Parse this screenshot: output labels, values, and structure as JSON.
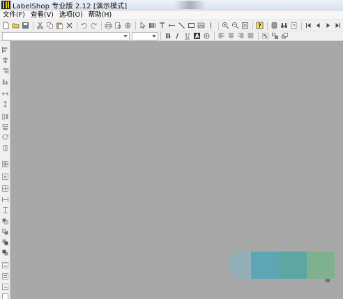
{
  "window": {
    "title": "LabelShop 专业版 2.12 [演示模式]"
  },
  "menu": {
    "items": [
      "文件(F)",
      "查看(V)",
      "选项(O)",
      "帮助(H)"
    ]
  },
  "toolbar1": {
    "icons": [
      "new-file-icon",
      "open-folder-icon",
      "save-icon",
      "cut-icon",
      "copy-icon",
      "paste-icon",
      "delete-icon",
      "undo-icon",
      "redo-icon",
      "print-icon",
      "print-preview-icon",
      "print-setup-icon",
      "pointer-icon",
      "barcode-icon",
      "text-icon",
      "line-icon",
      "diagonal-line-icon",
      "rectangle-icon",
      "image-icon",
      "vertical-line-icon",
      "zoom-in-icon",
      "zoom-out-icon",
      "fit-page-icon",
      "help-icon",
      "database-icon",
      "binoculars-icon",
      "database-update-icon",
      "first-record-icon",
      "prev-record-icon",
      "next-record-icon",
      "last-record-icon"
    ]
  },
  "toolbar2": {
    "font_name": "",
    "font_size": "",
    "style_icons": [
      "bold-icon",
      "italic-icon",
      "underline-icon",
      "font-color-icon",
      "rotate-text-icon"
    ],
    "align_icons": [
      "align-left-icon",
      "align-center-icon",
      "align-right-icon",
      "align-justify-icon",
      "group-icon",
      "ungroup-icon",
      "arrange-icon"
    ]
  },
  "colors": {
    "workspace": "#a8a8a8",
    "toolbar": "#f0f0f0"
  }
}
